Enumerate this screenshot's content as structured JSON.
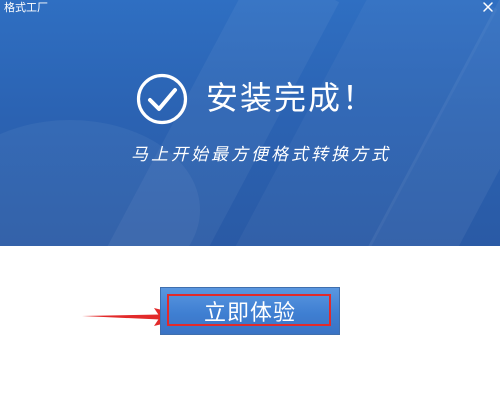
{
  "window": {
    "title": "格式工厂",
    "close_glyph": "×"
  },
  "hero": {
    "headline": "安装完成！",
    "subline": "马上开始最方便格式转换方式",
    "icon": "check-circle-icon"
  },
  "actions": {
    "start_label": "立即体验"
  },
  "colors": {
    "hero_bg": "#2b63b3",
    "button_bg": "#3f7fd2",
    "highlight_red": "#e22a2a"
  }
}
